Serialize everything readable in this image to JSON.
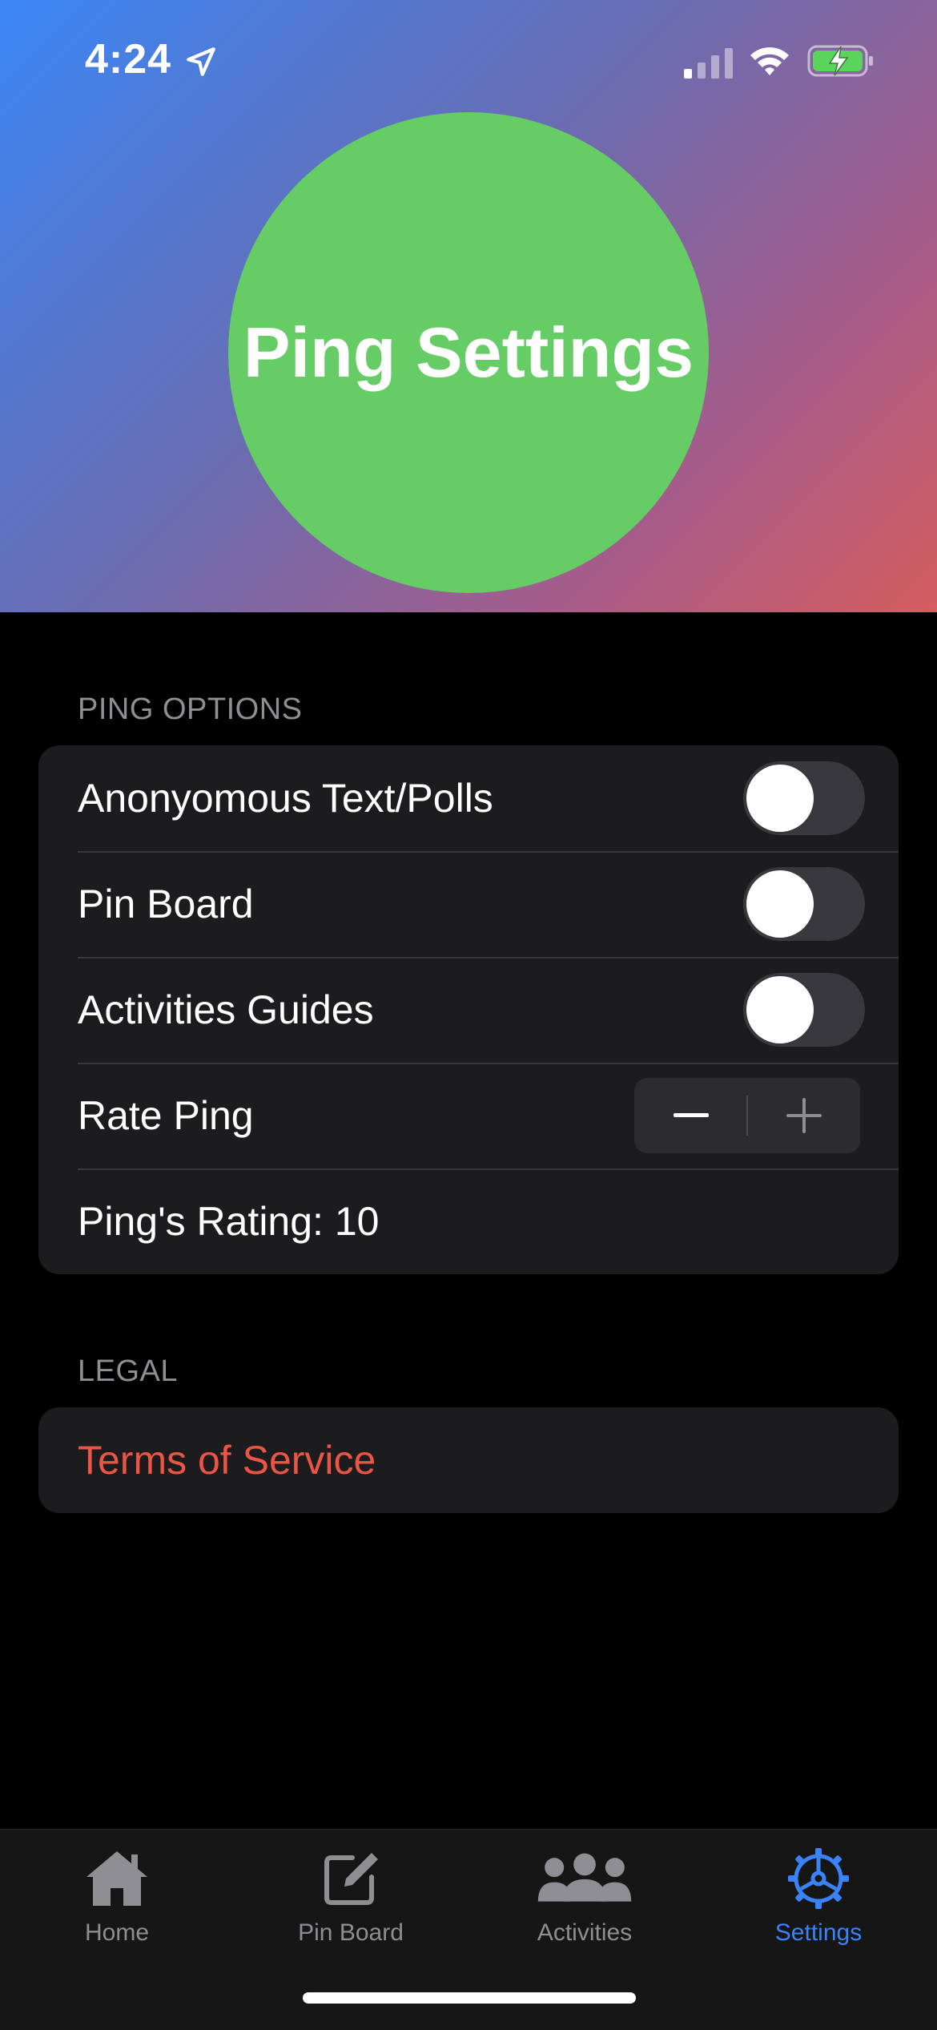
{
  "status_bar": {
    "time": "4:24"
  },
  "header": {
    "title": "Ping Settings"
  },
  "ping_options": {
    "header": "PING OPTIONS",
    "rows": [
      {
        "label": "Anonyomous Text/Polls",
        "control": "toggle",
        "on": false
      },
      {
        "label": "Pin Board",
        "control": "toggle",
        "on": false
      },
      {
        "label": "Activities Guides",
        "control": "toggle",
        "on": false
      },
      {
        "label": "Rate Ping",
        "control": "stepper"
      },
      {
        "label": "Ping's Rating: 10",
        "control": "none"
      }
    ]
  },
  "legal": {
    "header": "LEGAL",
    "terms_label": "Terms of Service"
  },
  "tab_bar": {
    "tabs": [
      {
        "label": "Home",
        "icon": "house-icon",
        "active": false
      },
      {
        "label": "Pin Board",
        "icon": "square-pencil-icon",
        "active": false
      },
      {
        "label": "Activities",
        "icon": "people-icon",
        "active": false
      },
      {
        "label": "Settings",
        "icon": "gear-icon",
        "active": true
      }
    ]
  },
  "colors": {
    "circle": "#66cd66",
    "gradient_start": "#3a86f5",
    "gradient_end": "#d45d5e",
    "accent": "#3a82f7",
    "destructive": "#eb5545",
    "group_bg": "#1c1c1e"
  }
}
